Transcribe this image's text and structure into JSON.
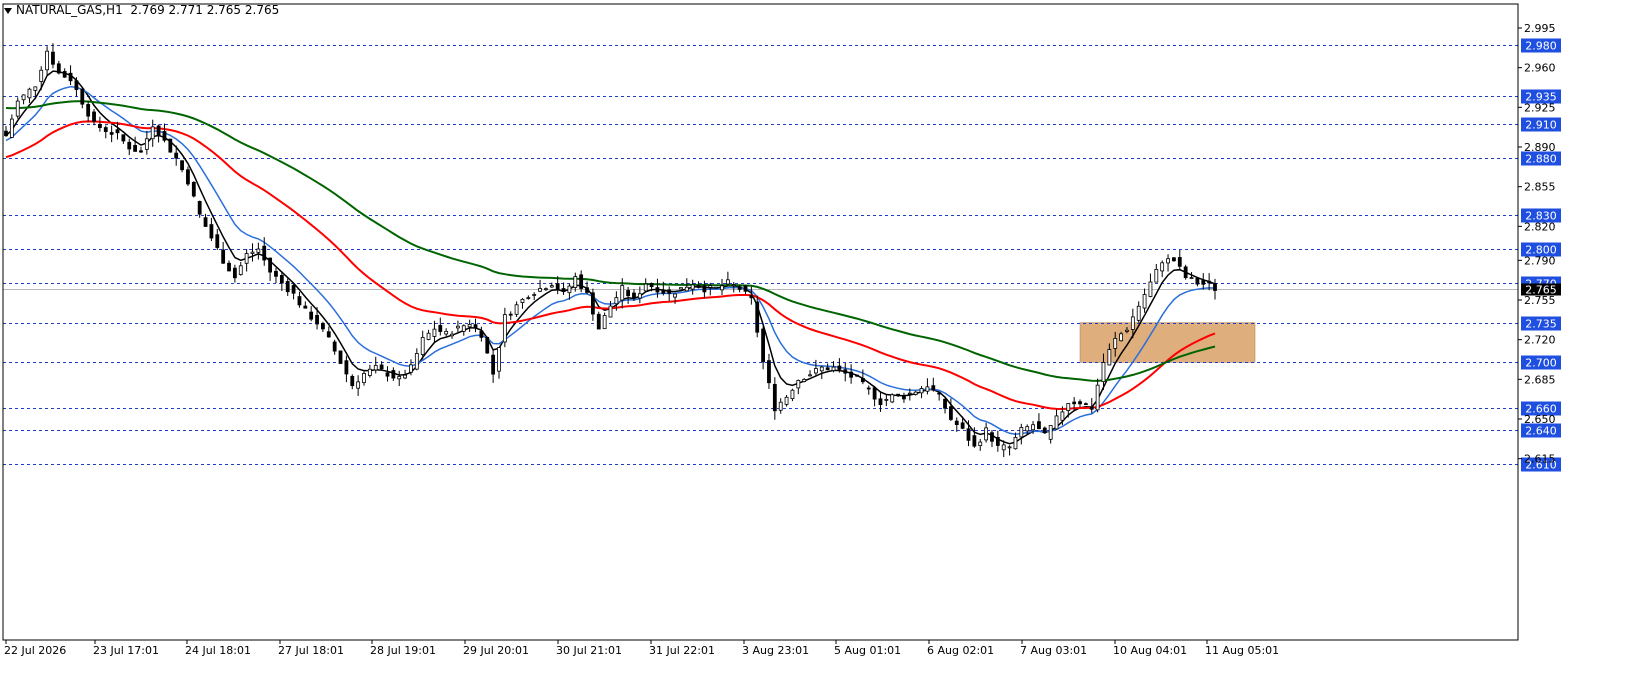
{
  "header": {
    "symbol": "NATURAL_GAS,H1",
    "ohlc": "2.769 2.771 2.765 2.765"
  },
  "colors": {
    "background": "#ffffff",
    "candle": "#000000",
    "level_line": "#1e3cc8",
    "price_tag_bg": "#1f4fe0",
    "ma_fast": "#000000",
    "ma_blue": "#2a6fdb",
    "ma_red": "#ff0000",
    "ma_green": "#006400",
    "zone": "#d9a066",
    "current_price_bg": "#000000"
  },
  "chart_data": {
    "type": "candlestick",
    "symbol": "NATURAL_GAS",
    "timeframe": "H1",
    "y_axis_ticks": [
      "2.995",
      "2.960",
      "2.925",
      "2.890",
      "2.855",
      "2.820",
      "2.790",
      "2.755",
      "2.720",
      "2.685",
      "2.650",
      "2.615"
    ],
    "x_axis_ticks": [
      "22 Jul 2026",
      "23 Jul 17:01",
      "24 Jul 18:01",
      "27 Jul 18:01",
      "28 Jul 19:01",
      "29 Jul 20:01",
      "30 Jul 21:01",
      "31 Jul 22:01",
      "3 Aug 23:01",
      "5 Aug 01:01",
      "6 Aug 02:01",
      "7 Aug 03:01",
      "10 Aug 04:01",
      "11 Aug 05:01"
    ],
    "horizontal_levels": [
      "2.980",
      "2.935",
      "2.910",
      "2.880",
      "2.830",
      "2.800",
      "2.770",
      "2.735",
      "2.700",
      "2.660",
      "2.640",
      "2.610"
    ],
    "current_price": "2.765",
    "zone": {
      "from_price": 2.7,
      "to_price": 2.735
    },
    "price_path": [
      [
        0,
        2.9
      ],
      [
        2,
        2.93
      ],
      [
        5,
        2.945
      ],
      [
        7,
        2.975
      ],
      [
        9,
        2.955
      ],
      [
        11,
        2.95
      ],
      [
        13,
        2.93
      ],
      [
        15,
        2.91
      ],
      [
        17,
        2.905
      ],
      [
        19,
        2.9
      ],
      [
        21,
        2.89
      ],
      [
        23,
        2.885
      ],
      [
        25,
        2.91
      ],
      [
        27,
        2.895
      ],
      [
        29,
        2.88
      ],
      [
        31,
        2.86
      ],
      [
        33,
        2.83
      ],
      [
        35,
        2.81
      ],
      [
        37,
        2.79
      ],
      [
        39,
        2.775
      ],
      [
        41,
        2.795
      ],
      [
        43,
        2.8
      ],
      [
        45,
        2.78
      ],
      [
        47,
        2.77
      ],
      [
        49,
        2.76
      ],
      [
        51,
        2.745
      ],
      [
        53,
        2.735
      ],
      [
        55,
        2.72
      ],
      [
        57,
        2.7
      ],
      [
        59,
        2.68
      ],
      [
        61,
        2.69
      ],
      [
        63,
        2.695
      ],
      [
        65,
        2.69
      ],
      [
        67,
        2.685
      ],
      [
        69,
        2.695
      ],
      [
        71,
        2.72
      ],
      [
        73,
        2.73
      ],
      [
        75,
        2.725
      ],
      [
        77,
        2.73
      ],
      [
        79,
        2.735
      ],
      [
        81,
        2.725
      ],
      [
        83,
        2.69
      ],
      [
        85,
        2.74
      ],
      [
        87,
        2.75
      ],
      [
        89,
        2.76
      ],
      [
        91,
        2.765
      ],
      [
        93,
        2.77
      ],
      [
        95,
        2.76
      ],
      [
        97,
        2.775
      ],
      [
        99,
        2.76
      ],
      [
        101,
        2.73
      ],
      [
        103,
        2.75
      ],
      [
        105,
        2.765
      ],
      [
        107,
        2.755
      ],
      [
        109,
        2.77
      ],
      [
        111,
        2.765
      ],
      [
        113,
        2.76
      ],
      [
        115,
        2.765
      ],
      [
        117,
        2.77
      ],
      [
        119,
        2.765
      ],
      [
        121,
        2.765
      ],
      [
        123,
        2.77
      ],
      [
        125,
        2.765
      ],
      [
        127,
        2.755
      ],
      [
        129,
        2.7
      ],
      [
        131,
        2.66
      ],
      [
        133,
        2.67
      ],
      [
        135,
        2.685
      ],
      [
        137,
        2.69
      ],
      [
        139,
        2.695
      ],
      [
        141,
        2.695
      ],
      [
        143,
        2.69
      ],
      [
        145,
        2.685
      ],
      [
        147,
        2.675
      ],
      [
        149,
        2.665
      ],
      [
        151,
        2.67
      ],
      [
        153,
        2.67
      ],
      [
        155,
        2.675
      ],
      [
        157,
        2.68
      ],
      [
        159,
        2.67
      ],
      [
        161,
        2.65
      ],
      [
        163,
        2.64
      ],
      [
        165,
        2.625
      ],
      [
        167,
        2.64
      ],
      [
        169,
        2.625
      ],
      [
        171,
        2.625
      ],
      [
        173,
        2.64
      ],
      [
        175,
        2.645
      ],
      [
        177,
        2.635
      ],
      [
        179,
        2.65
      ],
      [
        181,
        2.665
      ],
      [
        183,
        2.665
      ],
      [
        185,
        2.66
      ],
      [
        187,
        2.7
      ],
      [
        189,
        2.72
      ],
      [
        191,
        2.73
      ],
      [
        193,
        2.75
      ],
      [
        195,
        2.77
      ],
      [
        197,
        2.79
      ],
      [
        199,
        2.79
      ],
      [
        201,
        2.775
      ],
      [
        203,
        2.77
      ],
      [
        205,
        2.768
      ],
      [
        206,
        2.765
      ]
    ]
  }
}
